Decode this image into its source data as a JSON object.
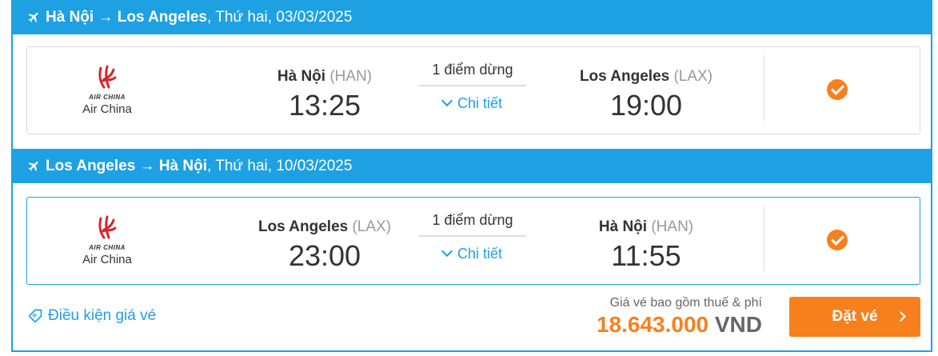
{
  "outbound": {
    "header": {
      "route": "Hà Nội → Los Angeles",
      "date": ", Thứ hai, 03/03/2025"
    },
    "airline": {
      "logo_text": "AIR CHINA",
      "name": "Air China"
    },
    "departure": {
      "city": "Hà Nội",
      "code": "(HAN)",
      "time": "13:25"
    },
    "stops": {
      "count": "1 điểm dừng",
      "detail": "Chi tiết"
    },
    "arrival": {
      "city": "Los Angeles",
      "code": "(LAX)",
      "time": "19:00"
    }
  },
  "return": {
    "header": {
      "route": "Los Angeles → Hà Nội",
      "date": ", Thứ hai, 10/03/2025"
    },
    "airline": {
      "logo_text": "AIR CHINA",
      "name": "Air China"
    },
    "departure": {
      "city": "Los Angeles",
      "code": "(LAX)",
      "time": "23:00"
    },
    "stops": {
      "count": "1 điểm dừng",
      "detail": "Chi tiết"
    },
    "arrival": {
      "city": "Hà Nội",
      "code": "(HAN)",
      "time": "11:55"
    }
  },
  "footer": {
    "conditions_label": "Điều kiện giá vé",
    "price_note": "Giá vé bao gồm thuế & phí",
    "price_amount": "18.643.000",
    "price_currency": "VND",
    "book_label": "Đặt vé"
  },
  "colors": {
    "accent": "#1ea1e3",
    "cta": "#f7801e",
    "airline_red": "#d7262e"
  },
  "icons": [
    "plane-icon",
    "air-china-logo",
    "chevron-down-icon",
    "check-circle-icon",
    "ticket-tag-icon",
    "chevron-right-icon"
  ]
}
